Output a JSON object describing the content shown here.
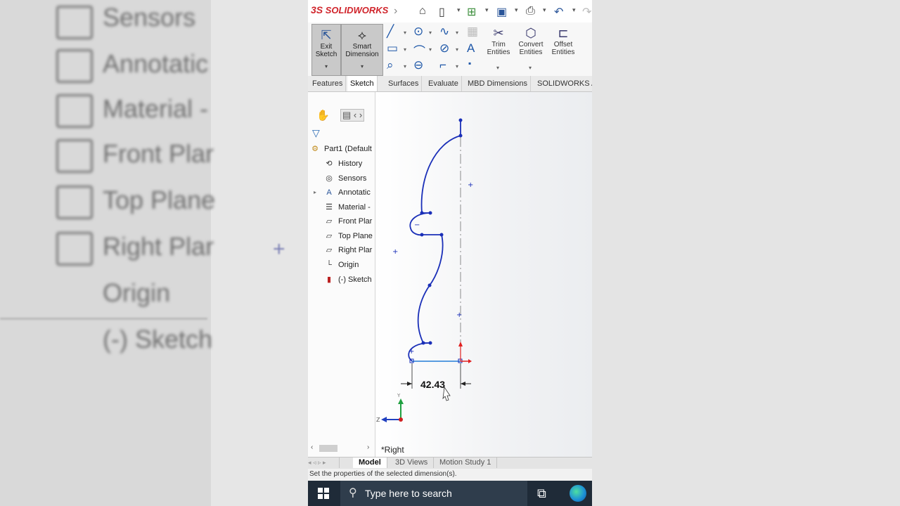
{
  "app": {
    "logo_prefix": "3S",
    "logo_text": "SOLIDWORKS"
  },
  "background": {
    "tree_items": [
      "Sensors",
      "Annotatic",
      "Material -",
      "Front Plar",
      "Top Plane",
      "Right Plar",
      "Origin",
      "(-) Sketch"
    ]
  },
  "ribbon": {
    "exit_sketch": "Exit Sketch",
    "smart_dimension": "Smart Dimension",
    "trim_entities": "Trim Entities",
    "convert_entities": "Convert Entities",
    "offset_entities": "Offset Entities"
  },
  "command_tabs": [
    "Features",
    "Sketch",
    "Surfaces",
    "Evaluate",
    "MBD Dimensions",
    "SOLIDWORKS A"
  ],
  "active_command_tab": "Sketch",
  "feature_tree": {
    "root": "Part1 (Default",
    "items": [
      "History",
      "Sensors",
      "Annotatic",
      "Material -",
      "Front Plar",
      "Top Plane",
      "Right Plar",
      "Origin",
      "(-) Sketch"
    ]
  },
  "graphics": {
    "dimension_value": "42.43",
    "view_name": "*Right"
  },
  "model_tabs": [
    "Model",
    "3D Views",
    "Motion Study 1"
  ],
  "status_text": "Set the properties of the selected dimension(s).",
  "taskbar": {
    "search_placeholder": "Type here to search"
  },
  "colors": {
    "sketch_line": "#1a2fb8",
    "brand_red": "#d0242b",
    "taskbar": "#1f2b38"
  }
}
